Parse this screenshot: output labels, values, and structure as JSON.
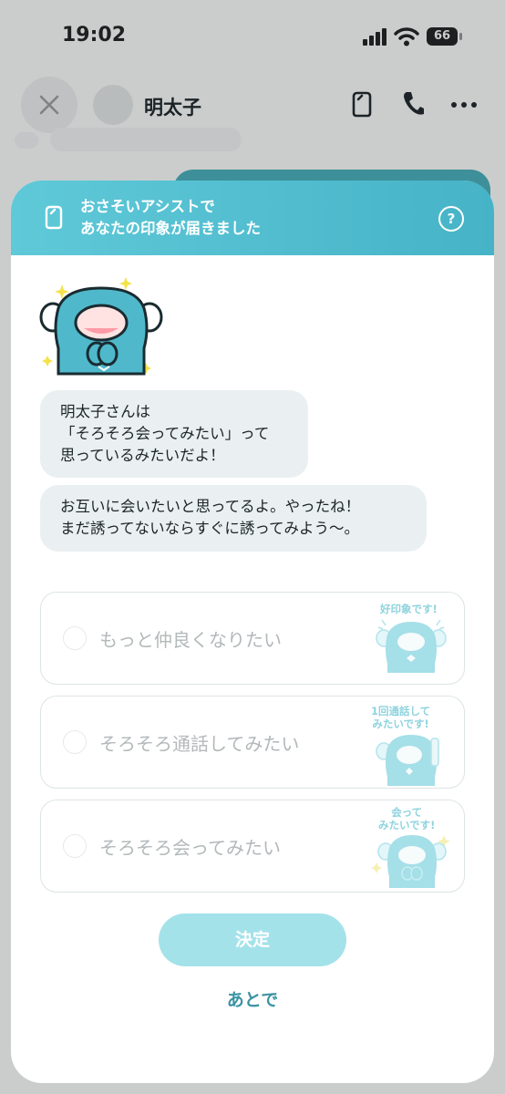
{
  "status_bar": {
    "time": "19:02",
    "battery": "66"
  },
  "header": {
    "contact_name": "明太子"
  },
  "modal": {
    "banner_line1": "おさそいアシストで",
    "banner_line2": "あなたの印象が届きました",
    "help_symbol": "?",
    "message1": [
      "明太子さんは",
      "「そろそろ会ってみたい」って",
      "思っているみたいだよ！"
    ],
    "message2": [
      "お互いに会いたいと思ってるよ。やったね！",
      "まだ誘ってないならすぐに誘ってみよう〜。"
    ],
    "options": [
      {
        "label": "もっと仲良くなりたい",
        "tag": [
          "好印象です!"
        ]
      },
      {
        "label": "そろそろ通話してみたい",
        "tag": [
          "1回通話して",
          "みたいです!"
        ]
      },
      {
        "label": "そろそろ会ってみたい",
        "tag": [
          "会って",
          "みたいです!"
        ]
      }
    ],
    "decide_label": "決定",
    "later_label": "あとで"
  },
  "colors": {
    "accent": "#4fbfd0",
    "button_disabled": "#a4e2ea",
    "link": "#3b93a3",
    "bubble": "#eaf0f1"
  },
  "icons": [
    "close-icon",
    "memo-icon",
    "phone-icon",
    "more-icon",
    "help-icon",
    "mascot-icon"
  ]
}
